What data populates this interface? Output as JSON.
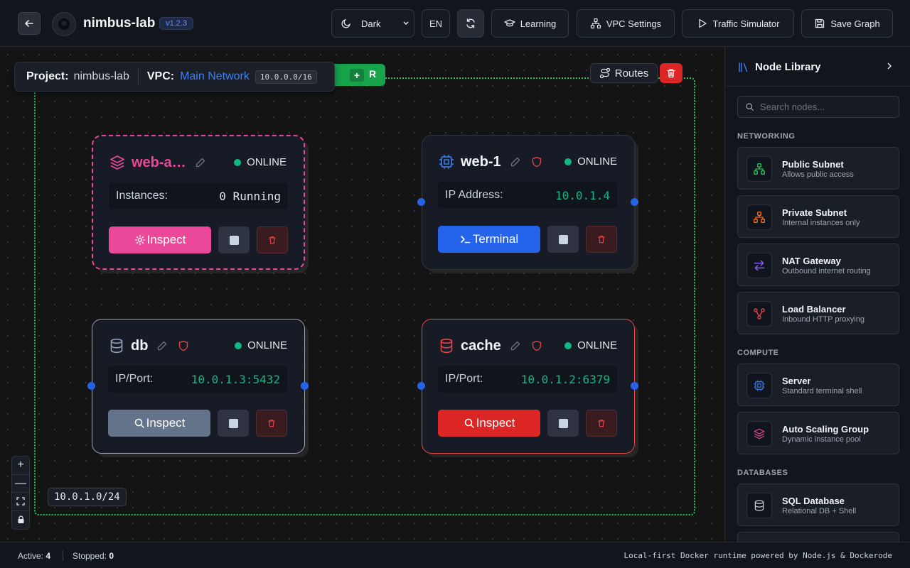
{
  "header": {
    "app_title": "nimbus-lab",
    "version": "v1.2.3",
    "theme_value": "Dark",
    "language": "EN",
    "buttons": {
      "learning": "Learning",
      "vpc_settings": "VPC Settings",
      "traffic_simulator": "Traffic Simulator",
      "save_graph": "Save Graph"
    }
  },
  "project_bar": {
    "project_label": "Project:",
    "project_name": "nimbus-lab",
    "vpc_label": "VPC:",
    "vpc_name": "Main Network",
    "vpc_cidr": "10.0.0.0/16",
    "tag_plus": "+",
    "tag_r": "R"
  },
  "vpc_controls": {
    "routes_label": "Routes"
  },
  "subnet_cidr": "10.0.1.0/24",
  "zoom_controls": {
    "in": "+",
    "out": "—"
  },
  "nodes": [
    {
      "name": "web-a…",
      "status": "ONLINE",
      "info_key": "Instances:",
      "info_value": "0 Running",
      "action": "Inspect",
      "accent": "#ec4899"
    },
    {
      "name": "web-1",
      "status": "ONLINE",
      "info_key": "IP Address:",
      "info_value": "10.0.1.4",
      "action": "Terminal",
      "accent": "#2563eb"
    },
    {
      "name": "db",
      "status": "ONLINE",
      "info_key": "IP/Port:",
      "info_value": "10.0.1.3:5432",
      "action": "Inspect",
      "accent": "#64748b"
    },
    {
      "name": "cache",
      "status": "ONLINE",
      "info_key": "IP/Port:",
      "info_value": "10.0.1.2:6379",
      "action": "Inspect",
      "accent": "#dc2626"
    }
  ],
  "sidebar": {
    "title": "Node Library",
    "search_placeholder": "Search nodes...",
    "sections": {
      "networking": "NETWORKING",
      "compute": "COMPUTE",
      "databases": "DATABASES"
    },
    "items": [
      {
        "title": "Public Subnet",
        "desc": "Allows public access",
        "icon": "network-icon",
        "color": "#22c55e"
      },
      {
        "title": "Private Subnet",
        "desc": "Internal instances only",
        "icon": "network-icon",
        "color": "#f97316"
      },
      {
        "title": "NAT Gateway",
        "desc": "Outbound internet routing",
        "icon": "arrows-icon",
        "color": "#8b5cf6"
      },
      {
        "title": "Load Balancer",
        "desc": "Inbound HTTP proxying",
        "icon": "split-icon",
        "color": "#ef4444"
      },
      {
        "title": "Server",
        "desc": "Standard terminal shell",
        "icon": "cpu-icon",
        "color": "#3b82f6"
      },
      {
        "title": "Auto Scaling Group",
        "desc": "Dynamic instance pool",
        "icon": "layers-icon",
        "color": "#ec4899"
      },
      {
        "title": "SQL Database",
        "desc": "Relational DB + Shell",
        "icon": "database-icon",
        "color": "#cbd5e1"
      }
    ]
  },
  "footer": {
    "active_label": "Active:",
    "active_count": "4",
    "stopped_label": "Stopped:",
    "stopped_count": "0",
    "powered_by": "Local-first Docker runtime powered by Node.js & Dockerode"
  }
}
